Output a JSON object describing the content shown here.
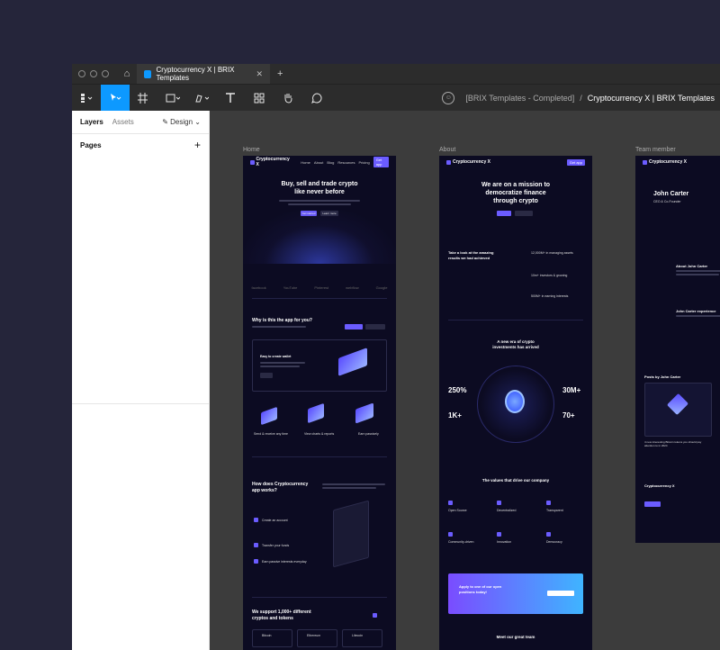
{
  "window": {
    "tab_title": "Cryptocurrency X | BRIX Templates",
    "tab_close": "✕",
    "new_tab": "+"
  },
  "toolbar": {
    "breadcrumb_project": "[BRIX Templates - Completed]",
    "breadcrumb_sep": "/",
    "breadcrumb_file": "Cryptocurrency X | BRIX Templates"
  },
  "left_panel": {
    "tab_layers": "Layers",
    "tab_assets": "Assets",
    "design_label": "Design",
    "pages_label": "Pages",
    "add_page": "+"
  },
  "canvas": {
    "frames": [
      {
        "label": "Home"
      },
      {
        "label": "About"
      },
      {
        "label": "Team member"
      }
    ],
    "home": {
      "logo": "Cryptocurrency X",
      "nav": [
        "Home",
        "About",
        "Blog",
        "Resources",
        "Pricing"
      ],
      "nav_btn": "Get app",
      "hero_line1": "Buy, sell and trade crypto",
      "hero_line2": "like never before",
      "btn_primary": "Get started",
      "btn_secondary": "Learn more",
      "logos": [
        "facebook",
        "YouTube",
        "Pinterest",
        "webflow",
        "Google"
      ],
      "why_title_1": "Why is this the app for you?",
      "why_card_title": "Easy to create wallet",
      "features": [
        "Send & receive any time",
        "View charts & reports",
        "Earn passively"
      ],
      "how_title_1": "How does Cryptocurrency",
      "how_title_2": "app works?",
      "steps": [
        "Create an account",
        "Transfer your funds",
        "Earn passive interests everyday"
      ],
      "support_title_1": "We support 1,000+ different",
      "support_title_2": "cryptos and tokens",
      "coins": [
        "Bitcoin",
        "Ethereum",
        "Litecoin"
      ]
    },
    "about": {
      "hero_line1": "We are on a mission to",
      "hero_line2": "democratize finance",
      "hero_line3": "through crypto",
      "achieved_1": "Take a look at the amazing",
      "achieved_2": "results we had achieved",
      "stats_small": [
        "12,000M+ in managing assets",
        "10m+ investors & growing",
        "500M+ in earning interests"
      ],
      "era_title_1": "A new era of crypto",
      "era_title_2": "investments has arrived",
      "big_stats": [
        "250%",
        "30M+",
        "1K+",
        "70+"
      ],
      "values_title": "The values that drive our company",
      "values": [
        "Open Source",
        "Decentralized",
        "Transparent",
        "Community-driven",
        "Innovation",
        "Democracy"
      ],
      "cta_1": "Apply to one of our open",
      "cta_2": "positions today!",
      "team_title": "Meet our great team"
    },
    "team": {
      "name": "John Carter",
      "role": "CEO & Co-Founder",
      "about_title": "About John Carter",
      "exp_title": "John Carter experience",
      "posts_title": "Posts by John Carter",
      "post_title": "4 new interesting Bitcoin tokens you should pay attention to in 2024"
    }
  }
}
